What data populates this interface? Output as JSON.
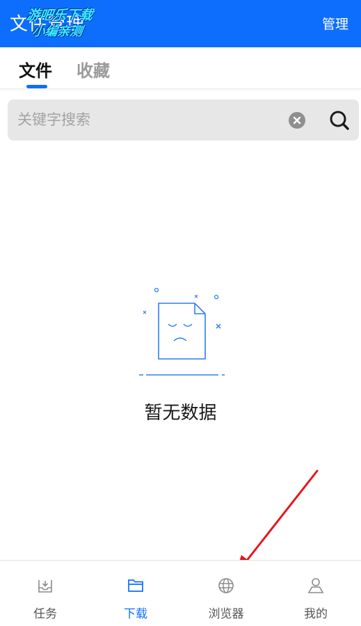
{
  "header": {
    "title": "文件管理",
    "manage_label": "管理",
    "watermark_line1": "游吧乐下载",
    "watermark_line2": "小编亲测"
  },
  "tabs": [
    {
      "label": "文件",
      "active": true
    },
    {
      "label": "收藏",
      "active": false
    }
  ],
  "search": {
    "placeholder": "关键字搜索",
    "value": ""
  },
  "empty_state": {
    "message": "暂无数据",
    "icon": "sad-document-icon"
  },
  "bottom_nav": [
    {
      "label": "任务",
      "icon": "tray-download-icon",
      "active": false
    },
    {
      "label": "下载",
      "icon": "folder-icon",
      "active": true
    },
    {
      "label": "浏览器",
      "icon": "globe-icon",
      "active": false
    },
    {
      "label": "我的",
      "icon": "profile-icon",
      "active": false
    }
  ],
  "colors": {
    "brand_blue": "#0d6efd",
    "annotation_red": "#e8141b"
  }
}
